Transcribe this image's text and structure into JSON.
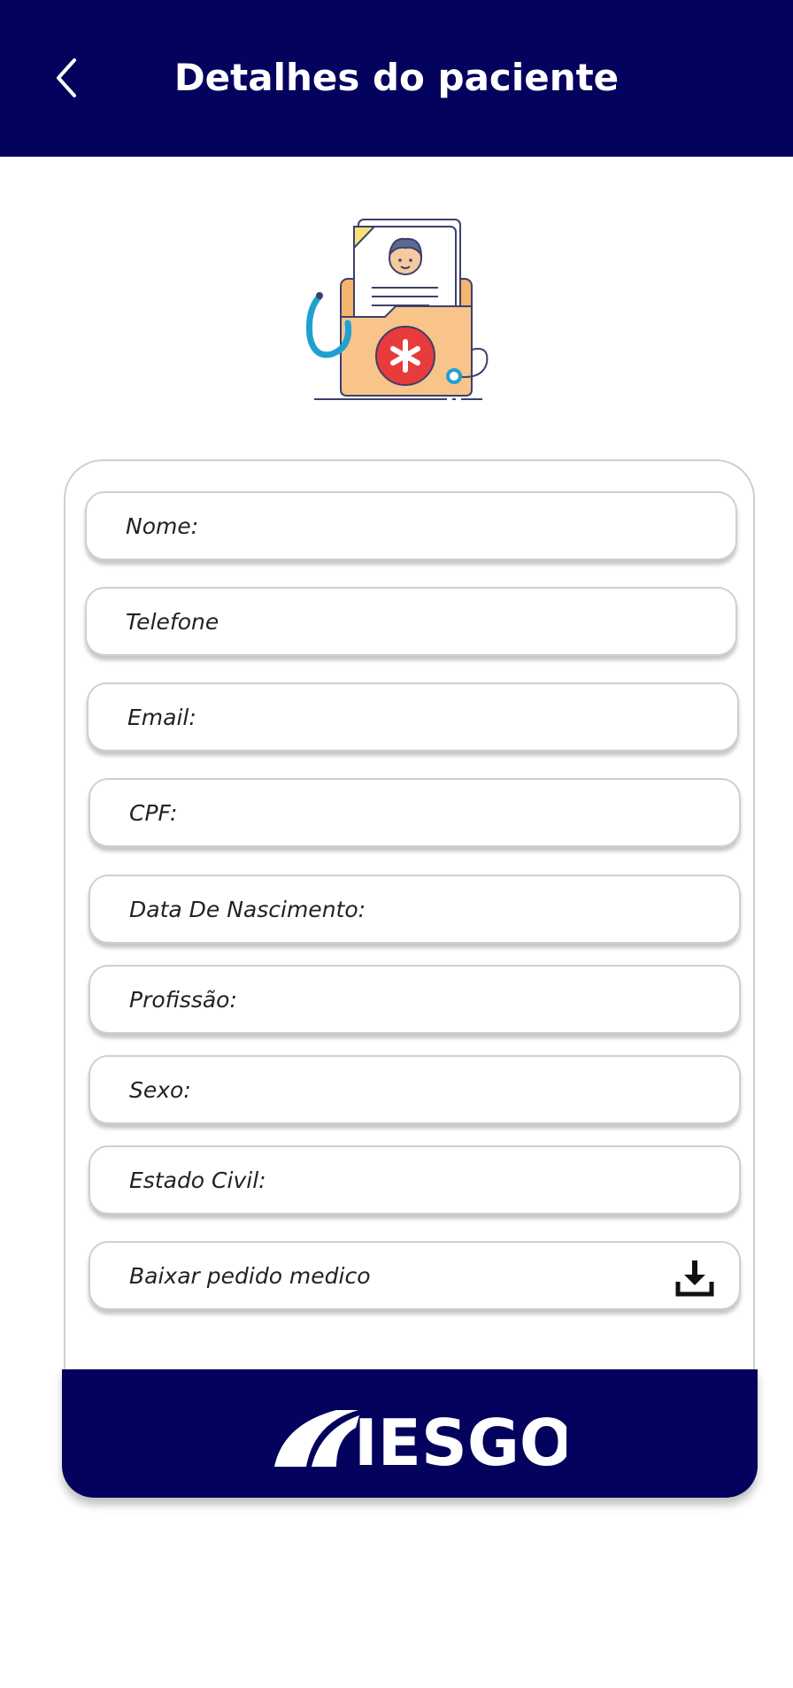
{
  "header": {
    "title": "Detalhes do paciente",
    "back_icon": "chevron-left-icon",
    "background": "#03035e"
  },
  "illustration": {
    "icon": "patient-folder-illustration"
  },
  "form": {
    "fields": [
      {
        "label": "Nome:"
      },
      {
        "label": "Telefone"
      },
      {
        "label": "Email:"
      },
      {
        "label": "CPF:"
      },
      {
        "label": "Data De Nascimento:"
      },
      {
        "label": "Profissão:"
      },
      {
        "label": "Sexo:"
      },
      {
        "label": "Estado Civil:"
      }
    ],
    "download": {
      "label": "Baixar pedido medico",
      "icon": "download-icon"
    }
  },
  "footer": {
    "logo_text": "IESGO",
    "background": "#03035e"
  }
}
